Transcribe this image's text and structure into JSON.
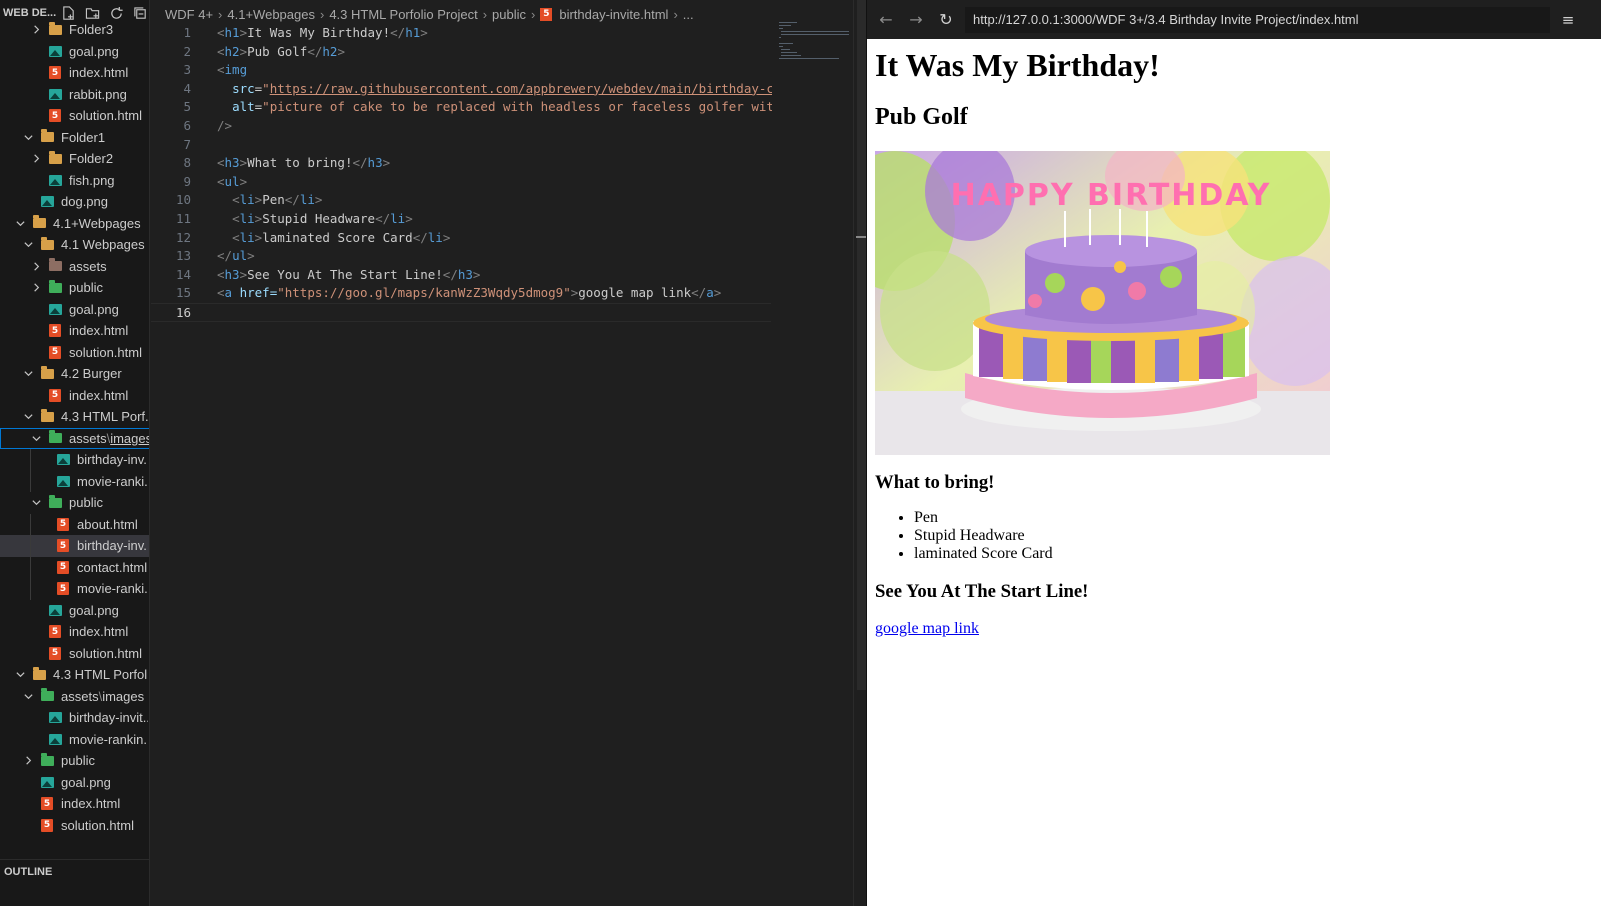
{
  "sidebar": {
    "title": "WEB DE...",
    "actions": [
      "new-file-icon",
      "new-folder-icon",
      "refresh-icon",
      "collapse-all-icon"
    ],
    "tree": [
      {
        "label": "Folder3",
        "type": "folder",
        "expanded": false
      },
      {
        "label": "goal.png",
        "type": "image"
      },
      {
        "label": "index.html",
        "type": "html"
      },
      {
        "label": "rabbit.png",
        "type": "image"
      },
      {
        "label": "solution.html",
        "type": "html"
      },
      {
        "label": "Folder1",
        "type": "folder",
        "expanded": true
      },
      {
        "label": "Folder2",
        "type": "folder",
        "expanded": false
      },
      {
        "label": "fish.png",
        "type": "image"
      },
      {
        "label": "dog.png",
        "type": "image"
      },
      {
        "label": "4.1+Webpages",
        "type": "folder",
        "expanded": true
      },
      {
        "label": "4.1 Webpages",
        "type": "folder",
        "expanded": true
      },
      {
        "label": "assets",
        "type": "folder",
        "expanded": false
      },
      {
        "label": "public",
        "type": "folder",
        "expanded": false
      },
      {
        "label": "goal.png",
        "type": "image"
      },
      {
        "label": "index.html",
        "type": "html"
      },
      {
        "label": "solution.html",
        "type": "html"
      },
      {
        "label": "4.2 Burger",
        "type": "folder",
        "expanded": true
      },
      {
        "label": "index.html",
        "type": "html"
      },
      {
        "label": "4.3 HTML Porf...",
        "type": "folder",
        "expanded": true
      },
      {
        "label": "assets",
        "label_rest": "images",
        "type": "folder",
        "expanded": true
      },
      {
        "label": "birthday-inv...",
        "type": "image"
      },
      {
        "label": "movie-ranki...",
        "type": "image"
      },
      {
        "label": "public",
        "type": "folder",
        "expanded": true
      },
      {
        "label": "about.html",
        "type": "html"
      },
      {
        "label": "birthday-inv...",
        "type": "html"
      },
      {
        "label": "contact.html",
        "type": "html"
      },
      {
        "label": "movie-ranki...",
        "type": "html"
      },
      {
        "label": "goal.png",
        "type": "image"
      },
      {
        "label": "index.html",
        "type": "html"
      },
      {
        "label": "solution.html",
        "type": "html"
      },
      {
        "label": "4.3 HTML Porfoli...",
        "type": "folder",
        "expanded": true
      },
      {
        "label": "assets",
        "label_rest": "images",
        "type": "folder",
        "expanded": true
      },
      {
        "label": "birthday-invit...",
        "type": "image"
      },
      {
        "label": "movie-rankin...",
        "type": "image"
      },
      {
        "label": "public",
        "type": "folder",
        "expanded": false
      },
      {
        "label": "goal.png",
        "type": "image"
      },
      {
        "label": "index.html",
        "type": "html"
      },
      {
        "label": "solution.html",
        "type": "html"
      }
    ],
    "outline_label": "OUTLINE"
  },
  "editor": {
    "breadcrumb": [
      "WDF 4+",
      "4.1+Webpages",
      "4.3 HTML Porfolio Project",
      "public",
      "birthday-invite.html",
      "..."
    ],
    "line_numbers": [
      "1",
      "2",
      "3",
      "4",
      "5",
      "6",
      "7",
      "8",
      "9",
      "10",
      "11",
      "12",
      "13",
      "14",
      "15",
      "16"
    ],
    "lines": [
      "<h1>It Was My Birthday!</h1>",
      "<h2>Pub Golf</h2>",
      "<img",
      "  src=\"https://raw.githubusercontent.com/appbrewery/webdev/main/birthday-c",
      "  alt=\"picture of cake to be replaced with headless or faceless golfer wit",
      "/>",
      "",
      "<h3>What to bring!</h3>",
      "<ul>",
      "  <li>Pen</li>",
      "  <li>Stupid Headware</li>",
      "  <li>laminated Score Card</li>",
      "</ul>",
      "<h3>See You At The Start Line!</h3>",
      "<a href=\"https://goo.gl/maps/kanWzZ3Wqdy5dmog9\">google map link</a>",
      ""
    ],
    "current_line": 16
  },
  "browser": {
    "url": "http://127.0.0.1:3000/WDF 3+/3.4 Birthday Invite Project/index.html",
    "back_icon": "back-arrow-icon",
    "forward_icon": "forward-arrow-icon",
    "reload_icon": "reload-icon",
    "menu_icon": "menu-icon",
    "page": {
      "h1": "It Was My Birthday!",
      "h2": "Pub Golf",
      "image_alt": "picture of cake to be replaced with headless or faceless golfer wit",
      "image_text": "HAPPY BIRTHDAY",
      "h3_bring": "What to bring!",
      "items": [
        "Pen",
        "Stupid Headware",
        "laminated Score Card"
      ],
      "h3_start": "See You At The Start Line!",
      "link_text": "google map link"
    }
  },
  "colors": {
    "accent": "#0078d4",
    "link": "#0000ee",
    "html_icon": "#e44d26",
    "image_icon": "#26a69a",
    "folder_icon": "#d7a049"
  }
}
